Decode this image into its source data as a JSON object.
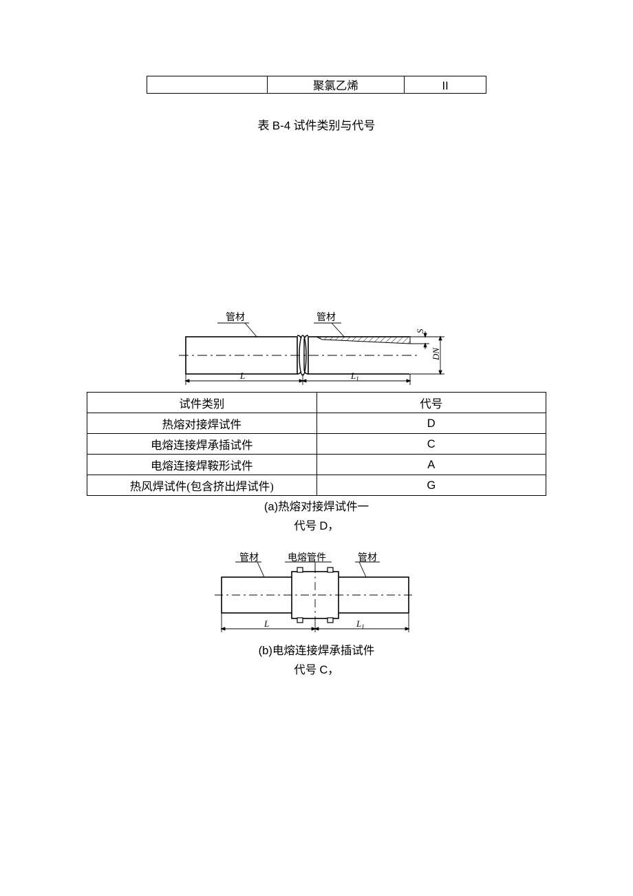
{
  "top_row": {
    "c1": "",
    "c2": "聚氯乙烯",
    "c3": "II"
  },
  "table_caption": {
    "pre": "表 ",
    "code": "B-4",
    "post": " 试件类别与代号"
  },
  "fig_a": {
    "label_left": "管材",
    "label_right": "管材",
    "dim_L": "L",
    "dim_L1": "L",
    "dim_L1_sub": "1",
    "dim_DN": "DN",
    "dim_S": "S"
  },
  "main_table": {
    "header_a": "试件类别",
    "header_b": "代号",
    "rows": [
      {
        "a": "热熔对接焊试件",
        "b": "D"
      },
      {
        "a": "电熔连接焊承插试件",
        "b": "C"
      },
      {
        "a": "电熔连接焊鞍形试件",
        "b": "A"
      },
      {
        "a": "热风焊试件(包含挤出焊试件)",
        "b": "G"
      }
    ]
  },
  "caption_a": {
    "prefix": "(a)",
    "text": "热熔对接焊试件一"
  },
  "caption_a_line2": {
    "pre": "代号 ",
    "code": "D",
    "post": "，"
  },
  "fig_b": {
    "label_left": "管材",
    "label_mid": "电熔管件",
    "label_right": "管材",
    "dim_L": "L",
    "dim_L1": "L",
    "dim_L1_sub": "1"
  },
  "caption_b": {
    "prefix": "(b)",
    "text": "电熔连接焊承插试件"
  },
  "caption_b_line2": {
    "pre": "代号 ",
    "code": "C",
    "post": "，"
  }
}
